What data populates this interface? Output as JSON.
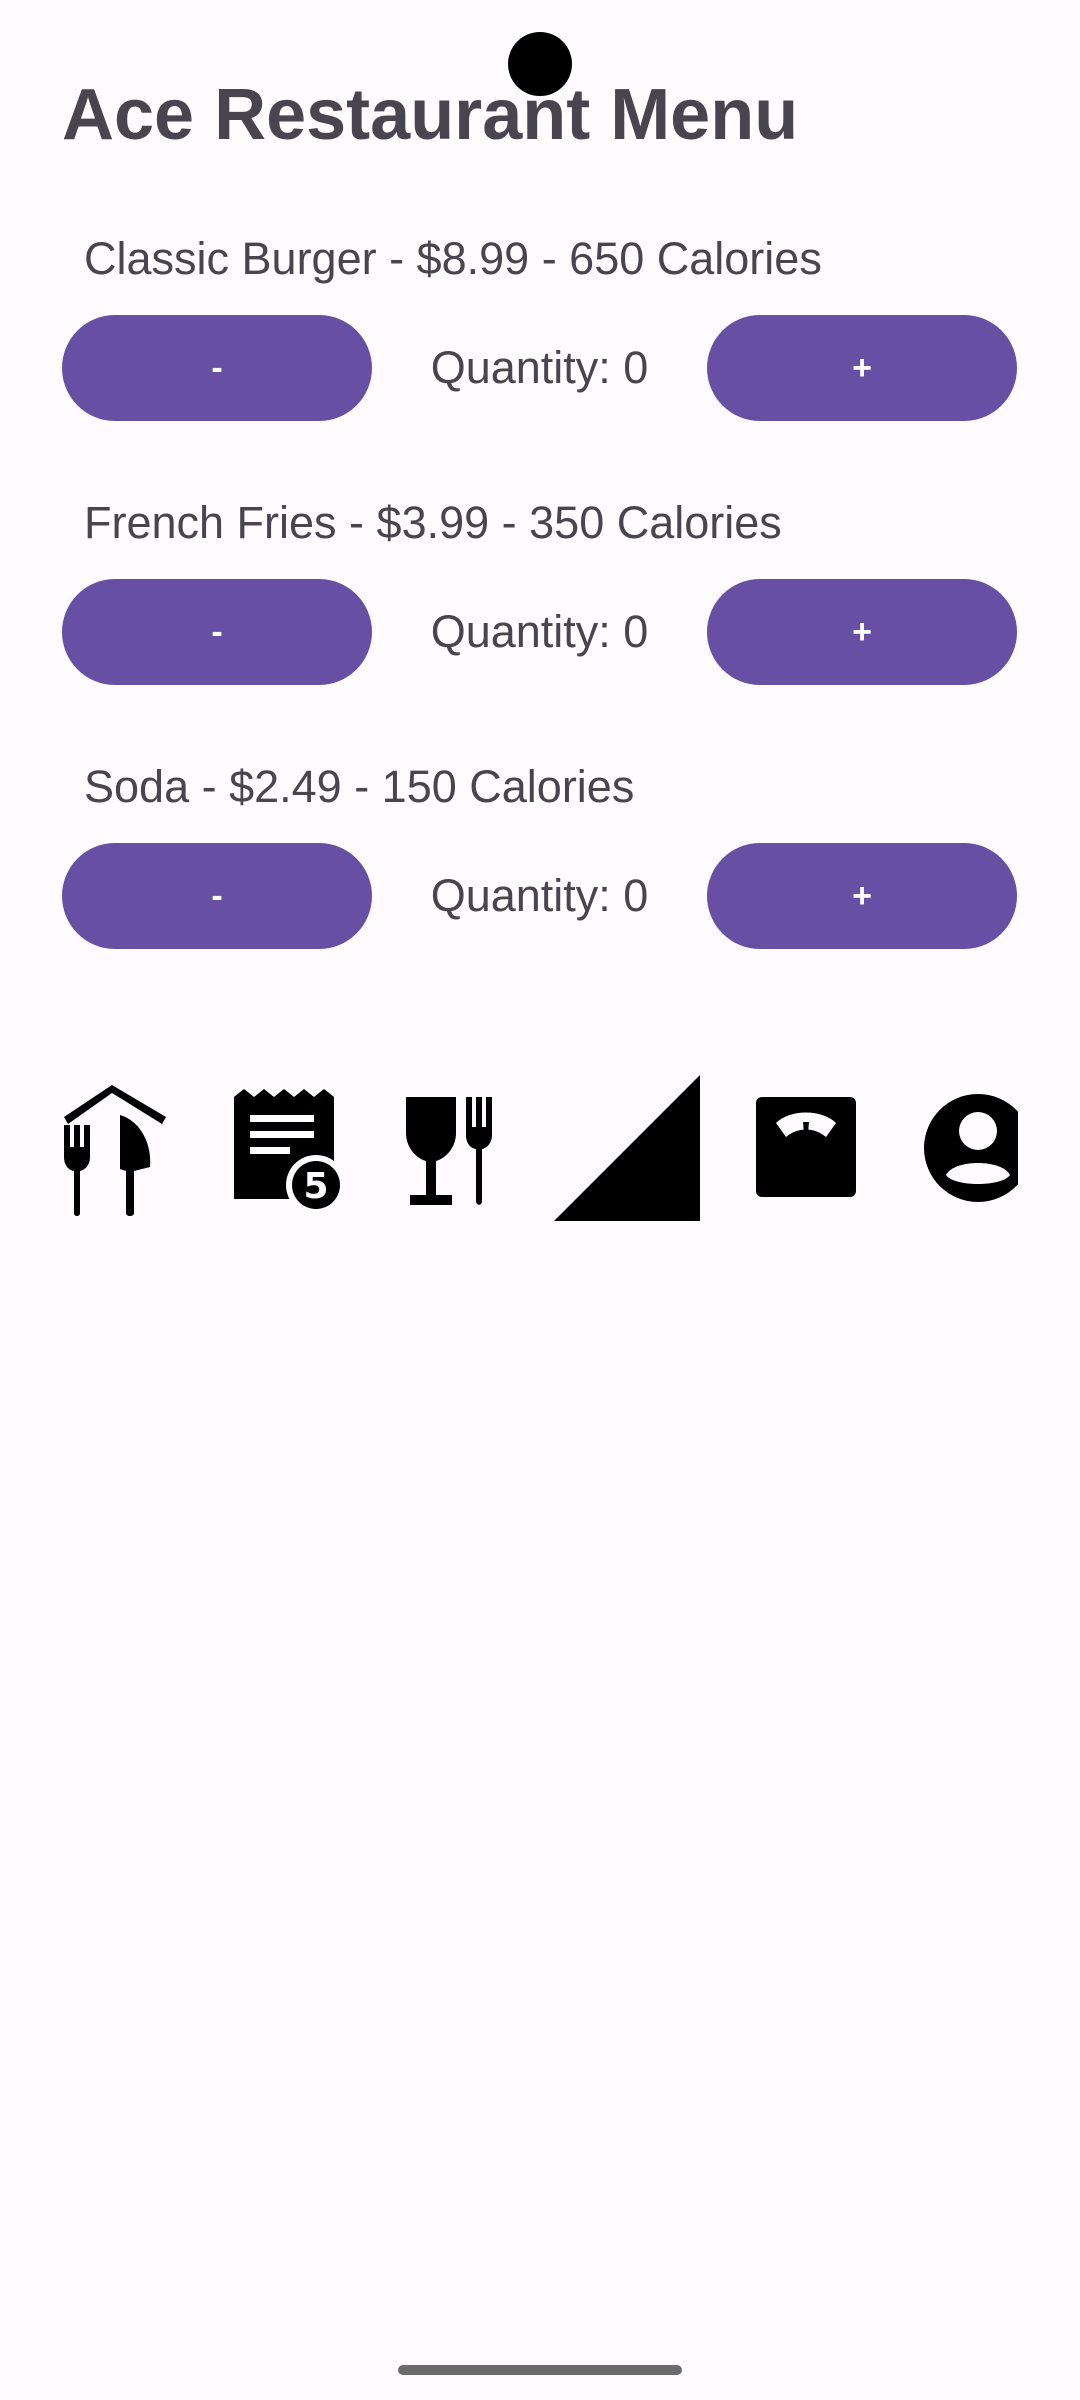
{
  "header": {
    "title": "Ace Restaurant Menu"
  },
  "menu": {
    "items": [
      {
        "label": "Classic Burger - $8.99 - 650 Calories",
        "minus_label": "-",
        "quantity": "Quantity: 0",
        "plus_label": "+"
      },
      {
        "label": "French Fries - $3.99 - 350 Calories",
        "minus_label": "-",
        "quantity": "Quantity: 0",
        "plus_label": "+"
      },
      {
        "label": "Soda - $2.49 - 150 Calories",
        "minus_label": "-",
        "quantity": "Quantity: 0",
        "plus_label": "+"
      }
    ]
  },
  "icons": [
    "restaurant-home-icon",
    "receipt-badge-icon",
    "wine-bar-icon",
    "signal-triangle-icon",
    "scale-icon",
    "account-circle-icon"
  ],
  "icon_badge": "5",
  "colors": {
    "background": "#fffbfe",
    "button": "#6750a4",
    "button_text": "#ffffff",
    "text": "#48454e"
  }
}
